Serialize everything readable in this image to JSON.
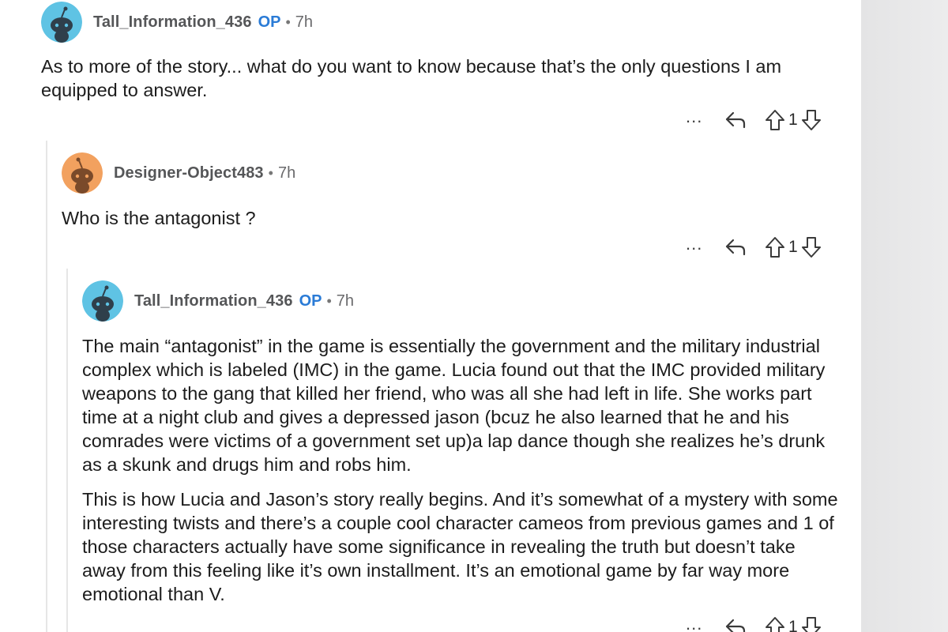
{
  "comments": [
    {
      "username": "Tall_Information_436",
      "op_badge": "OP",
      "separator": "•",
      "time": "7h",
      "avatar_color": "#5fc3e4",
      "body": [
        "As to more of the story... what do you want to know because that’s the only questions I am equipped to answer."
      ],
      "actions": {
        "more": "...",
        "score": "1"
      }
    },
    {
      "username": "Designer-Object483",
      "op_badge": "",
      "separator": "•",
      "time": "7h",
      "avatar_color": "#f2a15f",
      "body": [
        "Who is the antagonist ?"
      ],
      "actions": {
        "more": "...",
        "score": "1"
      }
    },
    {
      "username": "Tall_Information_436",
      "op_badge": "OP",
      "separator": "•",
      "time": "7h",
      "avatar_color": "#5fc3e4",
      "body": [
        "The main “antagonist” in the game is essentially the government and the military industrial complex which is labeled (IMC) in the game. Lucia found out that the IMC provided military weapons to the gang that killed her friend, who was all she had left in life. She works part time at a night club and gives a depressed jason (bcuz he also learned that he and his comrades were victims of a government set up)a lap dance though she realizes he’s drunk as a skunk and drugs him and robs him.",
        "This is how Lucia and Jason’s story really begins. And it’s somewhat of a mystery with some interesting twists and there’s a couple cool character cameos from previous games and 1 of those characters actually have some significance in revealing the truth but doesn’t take away from this feeling like it’s own installment. It’s an emotional game by far way more emotional than V."
      ],
      "actions": {
        "more": "...",
        "score": "1"
      }
    }
  ],
  "icons": {
    "reply": "reply-icon",
    "upvote": "upvote-arrow-icon",
    "downvote": "downvote-arrow-icon",
    "more": "more-options-icon"
  }
}
